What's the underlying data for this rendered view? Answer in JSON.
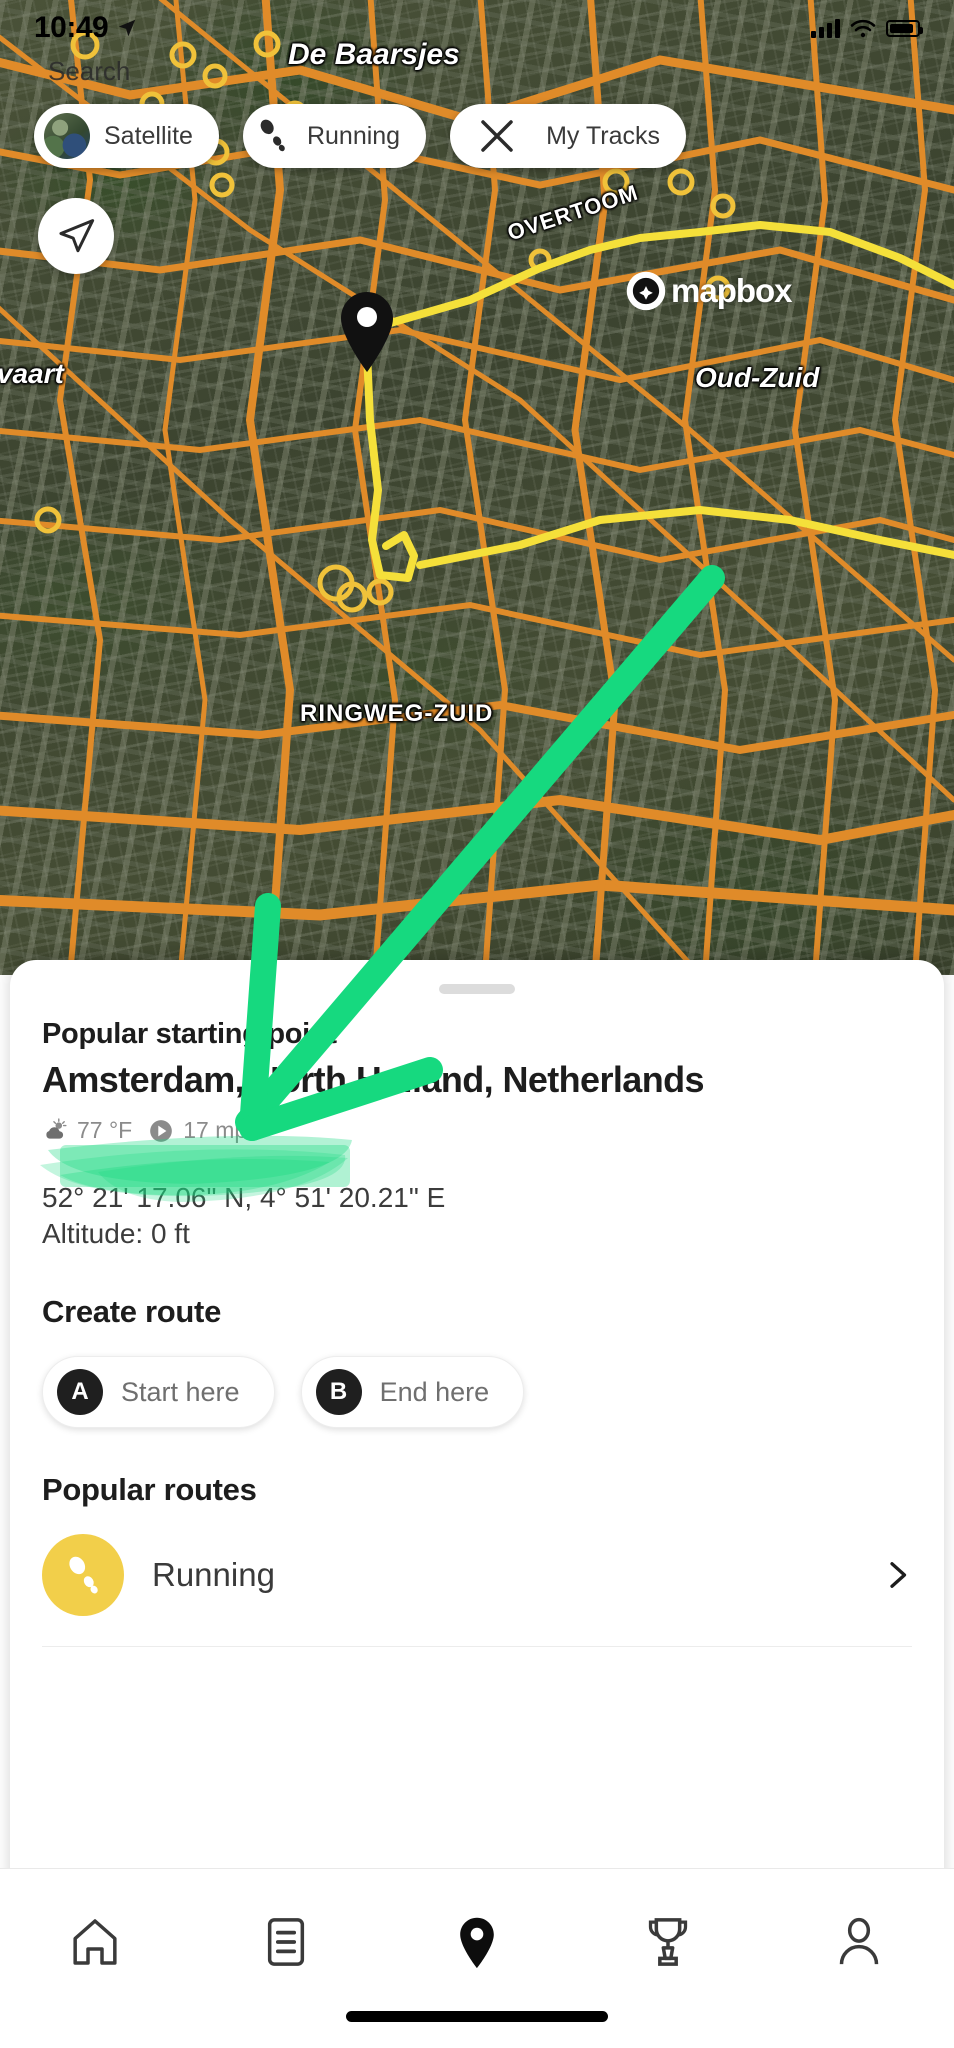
{
  "status_bar": {
    "time": "10:49",
    "location_arrow": "location-arrow-icon",
    "signal": "signal-bars-icon",
    "wifi": "wifi-icon",
    "battery": "battery-icon"
  },
  "map": {
    "search_hint": "Search",
    "labels": {
      "de_baarsjes": "De Baarsjes",
      "oud_zuid": "Oud-Zuid",
      "vaart": "rvaart",
      "overtoom": "OVERTOOM",
      "ringweg_zuid": "RINGWEG-ZUID"
    },
    "attribution": "mapbox",
    "chips": [
      {
        "label": "Satellite",
        "icon": "globe-icon"
      },
      {
        "label": "Running",
        "icon": "shoe-print-icon"
      },
      {
        "label": "My Tracks",
        "icon": "close-x-icon"
      }
    ],
    "locate_button": "navigation-arrow-icon",
    "pin": "map-pin-marker"
  },
  "sheet": {
    "eyebrow": "Popular starting point",
    "place": "Amsterdam, North Holland, Netherlands",
    "weather": {
      "temperature": "77 °F",
      "temperature_icon": "sun-cloud-icon",
      "wind": "17 mph",
      "wind_icon": "wind-direction-icon"
    },
    "coordinates": "52° 21' 17.06\" N, 4° 51' 20.21\" E",
    "altitude": "Altitude: 0 ft",
    "create_route": {
      "heading": "Create route",
      "buttons": [
        {
          "badge": "A",
          "label": "Start here"
        },
        {
          "badge": "B",
          "label": "End here"
        }
      ]
    },
    "popular_routes": {
      "heading": "Popular routes",
      "items": [
        {
          "label": "Running",
          "icon": "shoe-print-icon",
          "icon_bg": "#f2cf4a",
          "chevron": "chevron-right-icon"
        }
      ]
    }
  },
  "tab_bar": {
    "items": [
      {
        "name": "home",
        "icon": "home-icon",
        "active": false
      },
      {
        "name": "feed",
        "icon": "list-icon",
        "active": false
      },
      {
        "name": "map",
        "icon": "map-pin-icon",
        "active": true
      },
      {
        "name": "challenges",
        "icon": "trophy-icon",
        "active": false
      },
      {
        "name": "profile",
        "icon": "person-icon",
        "active": false
      }
    ]
  },
  "annotation": {
    "color": "#16d97f",
    "highlight_color": "#16d97f",
    "shapes": "arrow-pointing-to-weather-row + highlight-over-weather-row"
  },
  "colors": {
    "accent_yellow": "#f2cf4a",
    "annotation_green": "#16d97f",
    "text_primary": "#1d1d1d",
    "text_secondary": "#6f6f6f",
    "road_orange": "#e08b29"
  }
}
